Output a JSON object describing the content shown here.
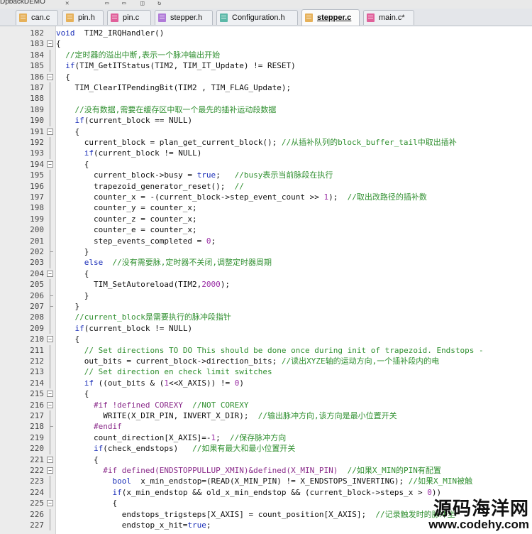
{
  "project_name": "DpbackDEMO",
  "toolbar_icons": [
    "undo-icon",
    "new-file-icon",
    "open-file-icon",
    "save-icon",
    "redo-icon"
  ],
  "tabs": [
    {
      "label": "can.c",
      "color": "#e6b15a",
      "active": false
    },
    {
      "label": "pin.h",
      "color": "#e6b15a",
      "active": false
    },
    {
      "label": "pin.c",
      "color": "#e0609a",
      "active": false
    },
    {
      "label": "stepper.h",
      "color": "#b07ad8",
      "active": false
    },
    {
      "label": "Configuration.h",
      "color": "#5bb8a8",
      "active": false
    },
    {
      "label": "stepper.c",
      "color": "#e6b15a",
      "active": true
    },
    {
      "label": "main.c*",
      "color": "#e0609a",
      "active": false
    }
  ],
  "lines": [
    {
      "n": "182",
      "fold": "",
      "segs": [
        [
          "kw",
          "void"
        ],
        [
          "",
          "  TIM2_IRQHandler()"
        ]
      ]
    },
    {
      "n": "183",
      "fold": "box",
      "segs": [
        [
          "",
          "{"
        ]
      ]
    },
    {
      "n": "184",
      "fold": "line",
      "segs": [
        [
          "",
          "  "
        ],
        [
          "cm",
          "//定时器的溢出中断,表示一个脉冲输出开始"
        ]
      ]
    },
    {
      "n": "185",
      "fold": "line",
      "segs": [
        [
          "",
          "  "
        ],
        [
          "kw",
          "if"
        ],
        [
          "",
          "(TIM_GetITStatus(TIM2, TIM_IT_Update) != RESET)"
        ]
      ]
    },
    {
      "n": "186",
      "fold": "box",
      "segs": [
        [
          "",
          "  {"
        ]
      ]
    },
    {
      "n": "187",
      "fold": "line",
      "segs": [
        [
          "",
          "    TIM_ClearITPendingBit(TIM2 , TIM_FLAG_Update);"
        ]
      ]
    },
    {
      "n": "188",
      "fold": "line",
      "segs": [
        [
          "",
          ""
        ]
      ]
    },
    {
      "n": "189",
      "fold": "line",
      "segs": [
        [
          "",
          "    "
        ],
        [
          "cm",
          "//没有数据,需要在缓存区中取一个最先的插补运动段数据"
        ]
      ]
    },
    {
      "n": "190",
      "fold": "line",
      "segs": [
        [
          "",
          "    "
        ],
        [
          "kw",
          "if"
        ],
        [
          "",
          "(current_block == NULL)"
        ]
      ]
    },
    {
      "n": "191",
      "fold": "box",
      "segs": [
        [
          "",
          "    {"
        ]
      ]
    },
    {
      "n": "192",
      "fold": "line",
      "segs": [
        [
          "",
          "      current_block = plan_get_current_block(); "
        ],
        [
          "cm",
          "//从插补队列的block_buffer_tail中取出插补"
        ]
      ]
    },
    {
      "n": "193",
      "fold": "line",
      "segs": [
        [
          "",
          "      "
        ],
        [
          "kw",
          "if"
        ],
        [
          "",
          "(current_block != NULL)"
        ]
      ]
    },
    {
      "n": "194",
      "fold": "box",
      "segs": [
        [
          "",
          "      {"
        ]
      ]
    },
    {
      "n": "195",
      "fold": "line",
      "segs": [
        [
          "",
          "        current_block->busy = "
        ],
        [
          "kw",
          "true"
        ],
        [
          "",
          ";   "
        ],
        [
          "cm",
          "//busy表示当前脉段在执行"
        ]
      ]
    },
    {
      "n": "196",
      "fold": "line",
      "segs": [
        [
          "",
          "        trapezoid_generator_reset();  "
        ],
        [
          "cm",
          "//"
        ]
      ]
    },
    {
      "n": "197",
      "fold": "line",
      "segs": [
        [
          "",
          "        counter_x = -(current_block->step_event_count >> "
        ],
        [
          "nm",
          "1"
        ],
        [
          "",
          ");  "
        ],
        [
          "cm",
          "//取出改路径的插补数"
        ]
      ]
    },
    {
      "n": "198",
      "fold": "line",
      "segs": [
        [
          "",
          "        counter_y = counter_x;"
        ]
      ]
    },
    {
      "n": "199",
      "fold": "line",
      "segs": [
        [
          "",
          "        counter_z = counter_x;"
        ]
      ]
    },
    {
      "n": "200",
      "fold": "line",
      "segs": [
        [
          "",
          "        counter_e = counter_x;"
        ]
      ]
    },
    {
      "n": "201",
      "fold": "line",
      "segs": [
        [
          "",
          "        step_events_completed = "
        ],
        [
          "nm",
          "0"
        ],
        [
          "",
          ";"
        ]
      ]
    },
    {
      "n": "202",
      "fold": "end",
      "segs": [
        [
          "",
          "      }"
        ]
      ]
    },
    {
      "n": "203",
      "fold": "line",
      "segs": [
        [
          "",
          "      "
        ],
        [
          "kw",
          "else"
        ],
        [
          "",
          "  "
        ],
        [
          "cm",
          "//没有需要脉,定时器不关闭,调整定时器周期"
        ]
      ]
    },
    {
      "n": "204",
      "fold": "box",
      "segs": [
        [
          "",
          "      {"
        ]
      ]
    },
    {
      "n": "205",
      "fold": "line",
      "segs": [
        [
          "",
          "        TIM_SetAutoreload(TIM2,"
        ],
        [
          "nm",
          "2000"
        ],
        [
          "",
          ");"
        ]
      ]
    },
    {
      "n": "206",
      "fold": "end",
      "segs": [
        [
          "",
          "      }"
        ]
      ]
    },
    {
      "n": "207",
      "fold": "end",
      "segs": [
        [
          "",
          "    }"
        ]
      ]
    },
    {
      "n": "208",
      "fold": "line",
      "segs": [
        [
          "",
          "    "
        ],
        [
          "cm",
          "//current_block是需要执行的脉冲段指针"
        ]
      ]
    },
    {
      "n": "209",
      "fold": "line",
      "segs": [
        [
          "",
          "    "
        ],
        [
          "kw",
          "if"
        ],
        [
          "",
          "(current_block != NULL)"
        ]
      ]
    },
    {
      "n": "210",
      "fold": "box",
      "segs": [
        [
          "",
          "    {"
        ]
      ]
    },
    {
      "n": "211",
      "fold": "line",
      "segs": [
        [
          "",
          "      "
        ],
        [
          "cm",
          "// Set directions TO DO This should be done once during init of trapezoid. Endstops -"
        ]
      ]
    },
    {
      "n": "212",
      "fold": "line",
      "segs": [
        [
          "",
          "      out_bits = current_block->direction_bits; "
        ],
        [
          "cm",
          "//读出XYZE轴的运动方向,一个插补段内的电"
        ]
      ]
    },
    {
      "n": "213",
      "fold": "line",
      "segs": [
        [
          "",
          "      "
        ],
        [
          "cm",
          "// Set direction en check limit switches"
        ]
      ]
    },
    {
      "n": "214",
      "fold": "line",
      "segs": [
        [
          "",
          "      "
        ],
        [
          "kw",
          "if"
        ],
        [
          "",
          " ((out_bits & ("
        ],
        [
          "nm",
          "1"
        ],
        [
          "",
          "<<X_AXIS)) != "
        ],
        [
          "nm",
          "0"
        ],
        [
          "",
          ")"
        ]
      ]
    },
    {
      "n": "215",
      "fold": "box",
      "segs": [
        [
          "",
          "      {"
        ]
      ]
    },
    {
      "n": "216",
      "fold": "box",
      "segs": [
        [
          "",
          "        "
        ],
        [
          "pp",
          "#if !defined COREXY"
        ],
        [
          "",
          "  "
        ],
        [
          "cm",
          "//NOT COREXY"
        ]
      ]
    },
    {
      "n": "217",
      "fold": "line",
      "segs": [
        [
          "",
          "          WRITE(X_DIR_PIN, INVERT_X_DIR);  "
        ],
        [
          "cm",
          "//输出脉冲方向,该方向是最小位置开关"
        ]
      ]
    },
    {
      "n": "218",
      "fold": "end",
      "segs": [
        [
          "",
          "        "
        ],
        [
          "pp",
          "#endif"
        ]
      ]
    },
    {
      "n": "219",
      "fold": "line",
      "segs": [
        [
          "",
          "        count_direction[X_AXIS]=-"
        ],
        [
          "nm",
          "1"
        ],
        [
          "",
          ";  "
        ],
        [
          "cm",
          "//保存脉冲方向"
        ]
      ]
    },
    {
      "n": "220",
      "fold": "line",
      "segs": [
        [
          "",
          "        "
        ],
        [
          "kw",
          "if"
        ],
        [
          "",
          "(check_endstops)   "
        ],
        [
          "cm",
          "//如果有最大和最小位置开关"
        ]
      ]
    },
    {
      "n": "221",
      "fold": "box",
      "segs": [
        [
          "",
          "        {"
        ]
      ]
    },
    {
      "n": "222",
      "fold": "box",
      "segs": [
        [
          "",
          "          "
        ],
        [
          "pp",
          "#if defined(ENDSTOPPULLUP_XMIN)&defined(X_MIN_PIN)"
        ],
        [
          "",
          "  "
        ],
        [
          "cm",
          "//如果X_MIN的PIN有配置"
        ]
      ]
    },
    {
      "n": "223",
      "fold": "line",
      "segs": [
        [
          "",
          "            "
        ],
        [
          "kw",
          "bool"
        ],
        [
          "",
          "  x_min_endstop=(READ(X_MIN_PIN) != X_ENDSTOPS_INVERTING); "
        ],
        [
          "cm",
          "//如果X_MIN被触"
        ]
      ]
    },
    {
      "n": "224",
      "fold": "line",
      "segs": [
        [
          "",
          "            "
        ],
        [
          "kw",
          "if"
        ],
        [
          "",
          "(x_min_endstop && old_x_min_endstop && (current_block->steps_x > "
        ],
        [
          "nm",
          "0"
        ],
        [
          "",
          "))"
        ]
      ]
    },
    {
      "n": "225",
      "fold": "box",
      "segs": [
        [
          "",
          "            {"
        ]
      ]
    },
    {
      "n": "226",
      "fold": "line",
      "segs": [
        [
          "",
          "              endstops_trigsteps[X_AXIS] = count_position[X_AXIS];  "
        ],
        [
          "cm",
          "//记录触发时的脉冲坐"
        ]
      ]
    },
    {
      "n": "227",
      "fold": "line",
      "segs": [
        [
          "",
          "              endstop_x_hit="
        ],
        [
          "kw",
          "true"
        ],
        [
          "",
          ";"
        ]
      ]
    }
  ],
  "watermark": {
    "line1": "源码海洋网",
    "line2": "www.codehy.com"
  }
}
